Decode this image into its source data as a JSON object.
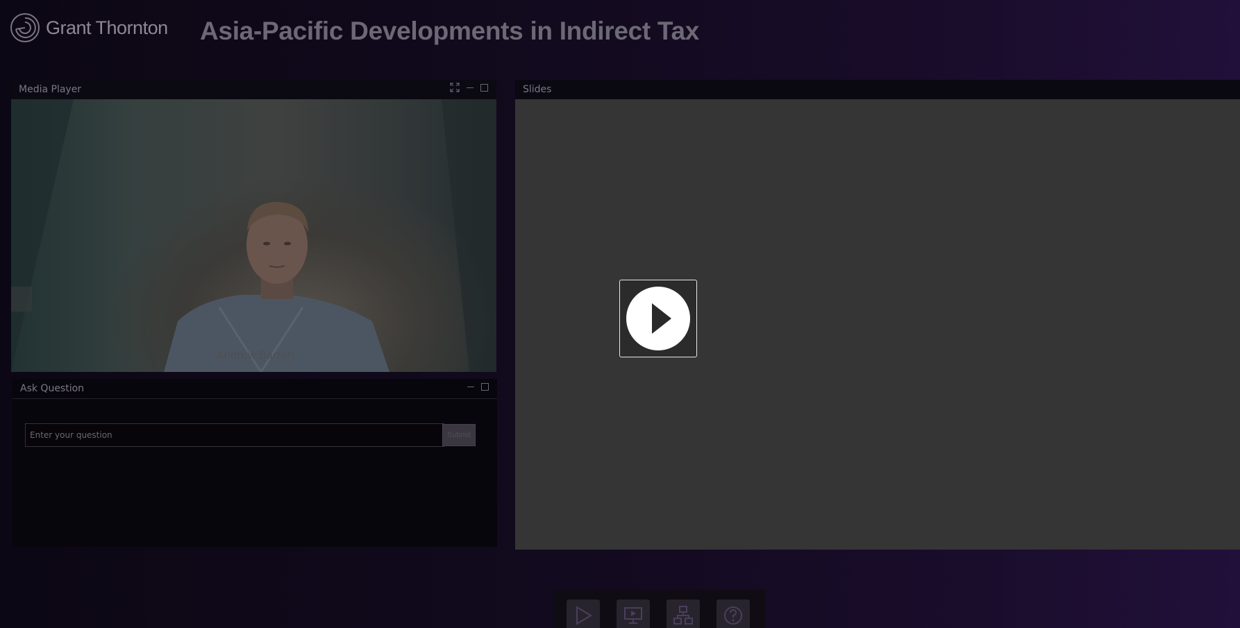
{
  "header": {
    "brand": "Grant Thornton",
    "title": "Asia-Pacific Developments in Indirect Tax"
  },
  "media_panel": {
    "title": "Media Player",
    "speaker_caption": "Andrew Barrah"
  },
  "question_panel": {
    "title": "Ask Question",
    "input_placeholder": "Enter your question",
    "submit_label": "Submit"
  },
  "slides_panel": {
    "title": "Slides"
  },
  "toolbar": {
    "buttons": [
      "play-icon",
      "presentation-icon",
      "network-icon",
      "help-icon"
    ]
  },
  "colors": {
    "accent_purple": "#21103a",
    "slide_bg": "#353535"
  }
}
